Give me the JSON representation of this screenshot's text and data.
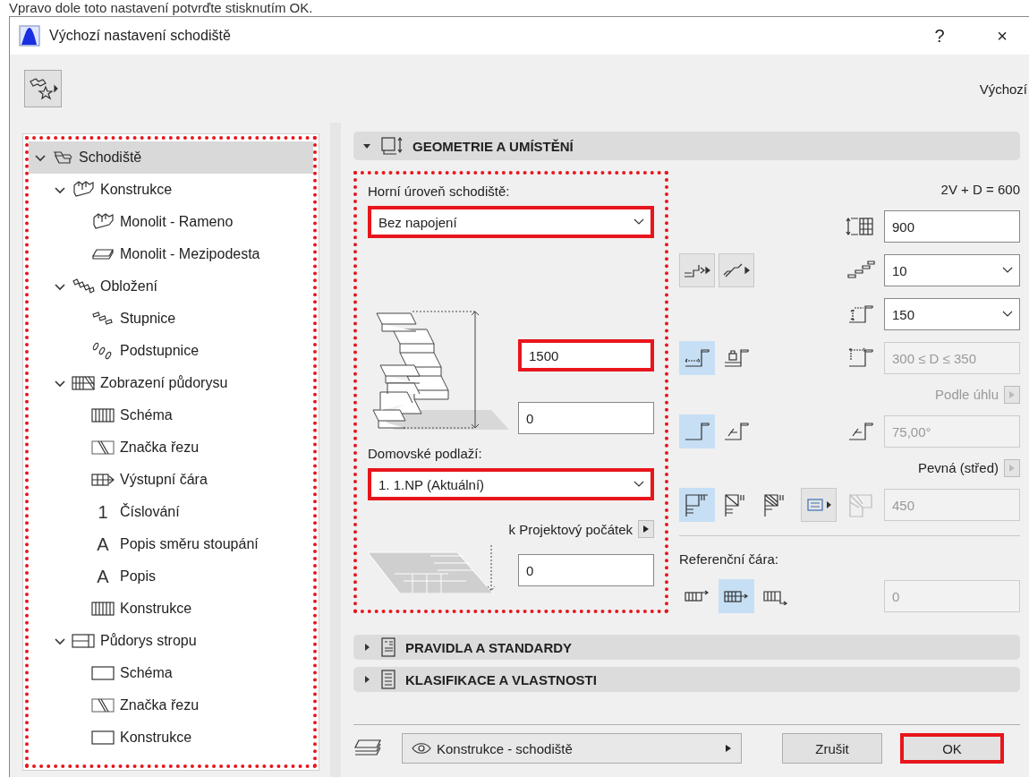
{
  "caption_text": "Vpravo dole toto nastavení potvrďte stisknutím OK.",
  "window": {
    "title": "Výchozí nastavení schodiště",
    "help_button": "?",
    "close_button": "×"
  },
  "toolbar": {
    "right_label": "Výchozí"
  },
  "tree": {
    "highlighted": true,
    "items": [
      {
        "label": "Schodiště",
        "kind": "stair",
        "selected": true,
        "expanded": true,
        "children": [
          {
            "label": "Konstrukce",
            "kind": "flight",
            "selected": false,
            "expanded": true,
            "children": [
              {
                "label": "Monolit - Rameno",
                "kind": "flight",
                "selected": false
              },
              {
                "label": "Monolit - Mezipodesta",
                "kind": "landing",
                "selected": false
              }
            ]
          },
          {
            "label": "Obložení",
            "kind": "cladding",
            "selected": false,
            "expanded": true,
            "children": [
              {
                "label": "Stupnice",
                "kind": "tread",
                "selected": false
              },
              {
                "label": "Podstupnice",
                "kind": "riser",
                "selected": false
              }
            ]
          },
          {
            "label": "Zobrazení půdorysu",
            "kind": "plan",
            "selected": false,
            "expanded": true,
            "children": [
              {
                "label": "Schéma",
                "kind": "scheme",
                "selected": false
              },
              {
                "label": "Značka řezu",
                "kind": "section",
                "selected": false
              },
              {
                "label": "Výstupní čára",
                "kind": "walkline",
                "selected": false
              },
              {
                "label": "Číslování",
                "kind": "glyph",
                "glyph": "1",
                "selected": false
              },
              {
                "label": "Popis směru stoupání",
                "kind": "glyph",
                "glyph": "A",
                "selected": false
              },
              {
                "label": "Popis",
                "kind": "glyph",
                "glyph": "A",
                "selected": false
              },
              {
                "label": "Konstrukce",
                "kind": "scheme",
                "selected": false
              }
            ]
          },
          {
            "label": "Půdorys stropu",
            "kind": "ceiling",
            "selected": false,
            "expanded": true,
            "children": [
              {
                "label": "Schéma",
                "kind": "outline",
                "selected": false
              },
              {
                "label": "Značka řezu",
                "kind": "section",
                "selected": false
              },
              {
                "label": "Konstrukce",
                "kind": "outline",
                "selected": false
              }
            ]
          }
        ]
      }
    ]
  },
  "sections": [
    {
      "title": "GEOMETRIE A UMÍSTĚNÍ",
      "expanded": true
    },
    {
      "title": "PRAVIDLA A STANDARDY",
      "expanded": false
    },
    {
      "title": "KLASIFIKACE A VLASTNOSTI",
      "expanded": false
    }
  ],
  "geometry": {
    "highlighted": true,
    "top_level_label": "Horní úroveň schodiště:",
    "top_level": {
      "value": "Bez napojení",
      "highlighted": true
    },
    "height": {
      "value": "1500",
      "highlighted": true
    },
    "base_offset": {
      "value": "0",
      "highlighted": false
    },
    "home_story_label": "Domovské podlaží:",
    "home_story": {
      "value": "1. 1.NP (Aktuální)",
      "highlighted": true
    },
    "origin_label": "k Projektový počátek",
    "origin_offset": {
      "value": "0",
      "highlighted": false
    },
    "formula": "2V + D = 600",
    "flight_width": {
      "value": "900",
      "disabled": false
    },
    "risers": {
      "value": "10"
    },
    "riser_height": {
      "value": "150"
    },
    "tread_depth": {
      "value": "300 ≤ D ≤ 350",
      "disabled": true
    },
    "angle_label": {
      "text": "Podle úhlu",
      "disabled": true
    },
    "angle": {
      "value": "75,00°",
      "disabled": true
    },
    "turn_label": {
      "text": "Pevná (střed)",
      "disabled": false
    },
    "turn": {
      "value": "450",
      "disabled": true
    },
    "reference_label": "Referenční čára:",
    "reference_offset": {
      "value": "0",
      "disabled": true
    },
    "tread_mode": [
      {
        "selected": true
      },
      {
        "selected": false
      }
    ],
    "riser_mode": [
      {
        "selected": true
      },
      {
        "selected": false
      }
    ],
    "turn_type": [
      {
        "selected": true
      },
      {
        "selected": false
      },
      {
        "selected": false
      }
    ],
    "reference_line": [
      {
        "selected": false
      },
      {
        "selected": true
      },
      {
        "selected": false
      }
    ]
  },
  "footer": {
    "layer": "Konstrukce - schodiště",
    "cancel": "Zrušit",
    "ok": {
      "label": "OK",
      "highlighted": true
    }
  }
}
